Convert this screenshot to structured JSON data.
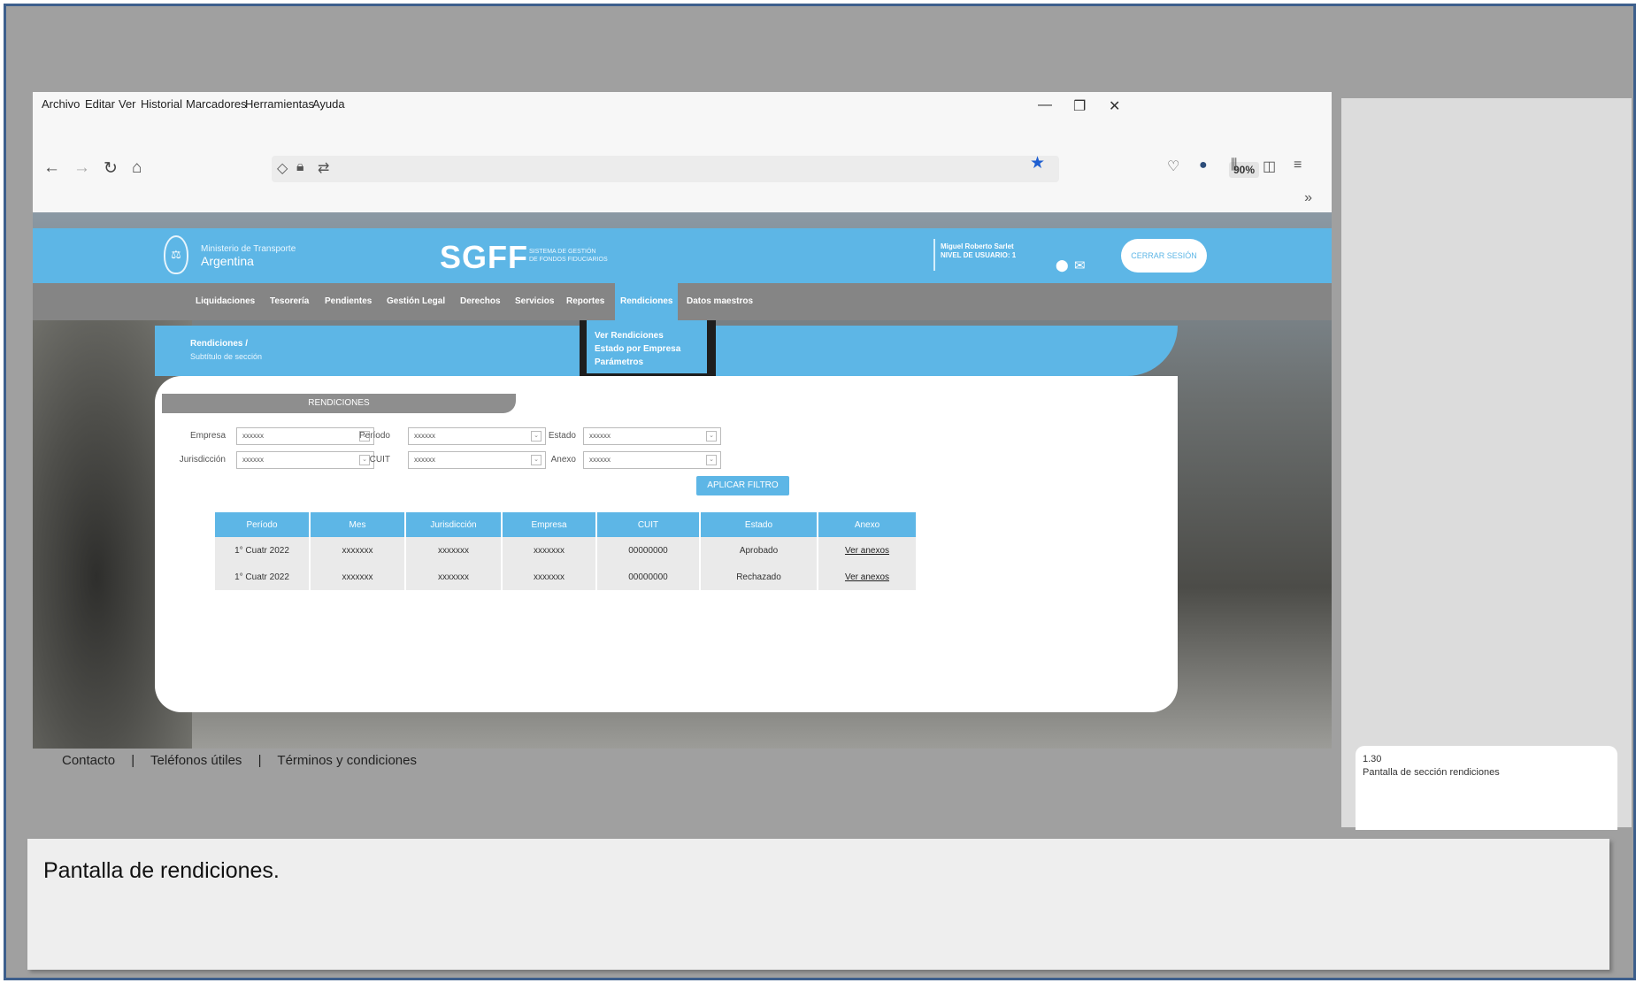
{
  "browser": {
    "menu": [
      "Archivo",
      "Editar",
      "Ver",
      "Historial",
      "Marcadores",
      "Herramientas",
      "Ayuda"
    ],
    "zoom": "90%"
  },
  "site": {
    "ministry": "Ministerio de Transporte",
    "country": "Argentina",
    "app_name": "SGFF",
    "app_sub_1": "SISTEMA DE GESTIÓN",
    "app_sub_2": "DE FONDOS FIDUCIARIOS",
    "user_name": "Miguel Roberto Sarlet",
    "user_level": "NIVEL DE USUARIO: 1",
    "logout": "CERRAR SESIÓN"
  },
  "nav": [
    "Liquidaciones",
    "Tesorería",
    "Pendientes",
    "Gestión Legal",
    "Derechos",
    "Servicios",
    "Reportes",
    "Rendiciones",
    "Datos maestros"
  ],
  "dropdown": [
    "Ver Rendiciones",
    "Estado por Empresa",
    "Parámetros"
  ],
  "breadcrumb": {
    "title": "Rendiciones  /",
    "subtitle": "Subtítulo de sección"
  },
  "panel": {
    "tab": "RENDICIONES",
    "filters": {
      "empresa_label": "Empresa",
      "periodo_label": "Período",
      "estado_label": "Estado",
      "jurisdiccion_label": "Jurisdicción",
      "cuit_label": "CUIT",
      "anexo_label": "Anexo",
      "value": "xxxxxx"
    },
    "apply": "APLICAR FILTRO"
  },
  "table": {
    "headers": [
      "Período",
      "Mes",
      "Jurisdicción",
      "Empresa",
      "CUIT",
      "Estado",
      "Anexo"
    ],
    "rows": [
      [
        "1° Cuatr 2022",
        "xxxxxxx",
        "xxxxxxx",
        "xxxxxxx",
        "00000000",
        "Aprobado",
        "Ver anexos"
      ],
      [
        "1° Cuatr 2022",
        "xxxxxxx",
        "xxxxxxx",
        "xxxxxxx",
        "00000000",
        "Rechazado",
        "Ver anexos"
      ]
    ]
  },
  "footer": {
    "links": [
      "Contacto",
      "Teléfonos útiles",
      "Términos y condiciones"
    ],
    "separator": "|"
  },
  "note": {
    "number": "1.30",
    "title": "Pantalla de sección rendiciones"
  },
  "caption": "Pantalla de rendiciones.",
  "colors": {
    "accent": "#5db6e6",
    "nav_bg": "#858585",
    "frame_border": "#3d5f8c"
  }
}
